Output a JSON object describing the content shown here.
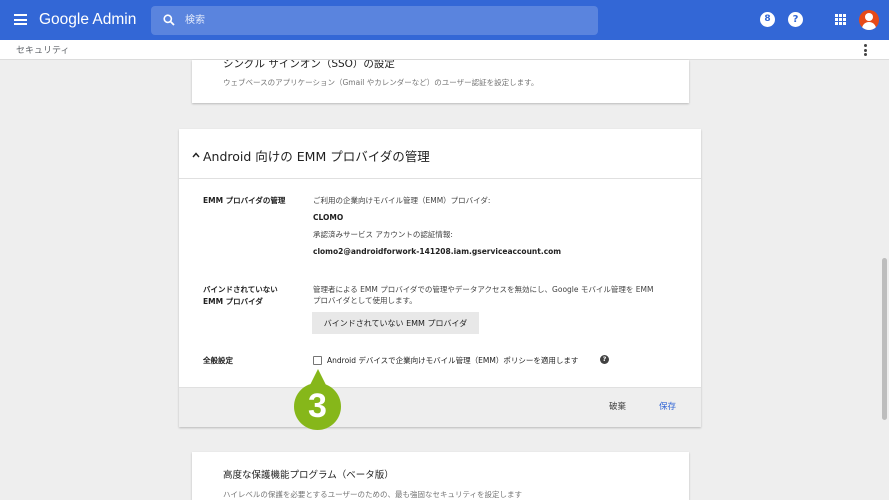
{
  "app": {
    "title": "Google Admin"
  },
  "search": {
    "placeholder": "検索"
  },
  "topbar": {
    "notification_badge": "8",
    "help_glyph": "?"
  },
  "breadcrumb": {
    "label": "セキュリティ"
  },
  "sso_card": {
    "title": "シングル サインオン（SSO）の設定",
    "description": "ウェブベースのアプリケーション（Gmail やカレンダーなど）のユーザー認証を設定します。"
  },
  "emm_card": {
    "title": "Android 向けの EMM プロバイダの管理",
    "provider_section": {
      "label": "EMM プロバイダの管理",
      "provider_caption": "ご利用の企業向けモバイル管理（EMM）プロバイダ:",
      "provider_name": "CLOMO",
      "account_caption": "承認済みサービス アカウントの認証情報:",
      "account_email": "clomo2@androidforwork-141208.iam.gserviceaccount.com"
    },
    "unbind_section": {
      "label_line1": "バインドされていない",
      "label_line2": "EMM プロバイダ",
      "desc_line1": "管理者による EMM プロバイダでの管理やデータアクセスを無効にし、Google モバイル管理を EMM",
      "desc_line2": "プロバイダとして使用します。",
      "button_label": "バインドされていない EMM プロバイダ"
    },
    "general_section": {
      "label": "全般設定",
      "checkbox_label": "Android デバイスで企業向けモバイル管理（EMM）ポリシーを適用します",
      "checked": false
    },
    "footer": {
      "discard_label": "破棄",
      "save_label": "保存"
    }
  },
  "step_marker": {
    "number": "3",
    "color": "#86b71a"
  },
  "advanced_card": {
    "title": "高度な保護機能プログラム（ベータ版）",
    "description": "ハイレベルの保護を必要とするユーザーのための、最も強固なセキュリティを設定します"
  },
  "colors": {
    "brand": "#3367d6",
    "background": "#eeeeee",
    "avatar": "#e64a19"
  },
  "icons": [
    "menu-icon",
    "search-icon",
    "notification-icon",
    "help-icon",
    "apps-icon",
    "account-avatar",
    "more-vert-icon",
    "chevron-up-icon",
    "help-circle-icon"
  ]
}
